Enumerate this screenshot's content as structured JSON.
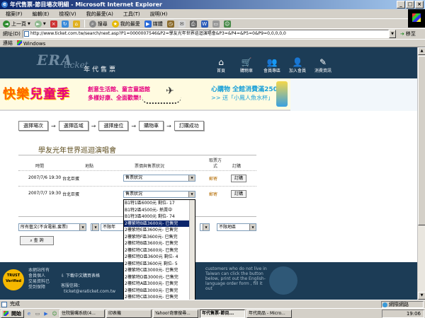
{
  "window": {
    "title": "年代售票-節目場次明細 - Microsoft Internet Explorer",
    "controls": [
      "_",
      "□",
      "×"
    ]
  },
  "menu": [
    "檔案(F)",
    "編輯(E)",
    "檢視(V)",
    "我的最愛(A)",
    "工具(T)",
    "說明(H)"
  ],
  "toolbar": {
    "back": "上一頁",
    "search": "搜尋",
    "favorites": "我的最愛",
    "media": "媒體"
  },
  "address": {
    "label": "網址(D)",
    "url": "http://www.ticket.com.tw/search/next.asp?P1=0000007546&P2=學友光年世界巡迴演唱會&P3=&P4=&P5=0&P9=0,0,0,0,0",
    "go": "移至"
  },
  "links": {
    "label": "連結",
    "item": "Windows"
  },
  "site": {
    "logo": "ERA",
    "logo_sub": "ticket",
    "name": "年代售票",
    "nav": [
      {
        "icon": "⌂",
        "label": "首頁"
      },
      {
        "icon": "🛒",
        "label": "購物車"
      },
      {
        "icon": "👥",
        "label": "會員專區"
      },
      {
        "icon": "👤",
        "label": "加入會員"
      },
      {
        "icon": "✎",
        "label": "消費資訊"
      }
    ]
  },
  "banner": {
    "title_a": "快樂",
    "title_b": "兒童季",
    "slogan1": "創意生活館、童言童語館",
    "slogan2": "多樣好康、全面歡樂!",
    "buy1": "心購物 全館消費滿2500",
    "buy2": ">> 送「小鳳人魚水杯」"
  },
  "steps": [
    "選擇場次",
    "選擇區域",
    "選擇座位",
    "購物車",
    "訂購成功"
  ],
  "event": {
    "title": "學友光年世界巡迴演唱會",
    "headers": [
      "時間",
      "地點",
      "票價與售票狀況",
      "取票方式",
      "訂購"
    ],
    "rows": [
      {
        "time": "2007/7/6 19:30",
        "place": "台北巨蛋",
        "status": "售票狀況",
        "pickup": "郵寄",
        "buy": "訂購"
      },
      {
        "time": "2007/7/7 19:30",
        "place": "台北巨蛋",
        "status": "售票狀況",
        "pickup": "郵寄",
        "buy": "訂購"
      }
    ]
  },
  "dropdown": {
    "items": [
      "B1特1區6000元 剩位- 17",
      "B1特2區4500元- 熱賣中",
      "B1特3區4000元 剩位- 74",
      "2樓紫特B區3600元- 已售完",
      "2樓紫特E區3600元- 已售完",
      "2樓紫特F區3600元- 已售完",
      "2樓紅特B區3600元- 已售完",
      "2樓紅特C區3600元- 已售完",
      "2樓紅特D區3600元 剩位- 4",
      "2樓紅特E區3600元 剩位- 5",
      "2樓紫特C區3000元- 已售完",
      "2樓紫特D區3000元- 已售完",
      "2樓紅特A區3000元- 已售完",
      "2樓紅特B區3000元- 已售完",
      "2樓紅特C區3000元- 已售完",
      "2樓紅特D區3000元- 已售完",
      "2樓紅特E區3000元- 已售完"
    ],
    "selected_index": 3
  },
  "filters": {
    "category": "所有藝文(不含電影,套票)",
    "date": "不限年",
    "region": "不限地區",
    "search": "查 詢"
  },
  "footer": {
    "trust": "TRUST Verified",
    "text1": "本網站所有",
    "text2": "會員個人",
    "text3": "交易資料已",
    "text4": "受到保障",
    "download": "下載中文購買表格",
    "mail_label": "客服信箱：",
    "mail": "ticket@eraticket.com.tw",
    "eng": "customers who do not live in Taiwan can click the button below, print out the English-language order form , fill it out"
  },
  "status": {
    "text": "完成",
    "zone": "網際網路"
  },
  "taskbar": {
    "start": "開始",
    "items": [
      "住院醫囑系統(4...",
      "印表機",
      "Yahoo!奇摩搜尋...",
      "年代售票-節目...",
      "年代商品 - Micro..."
    ],
    "active_index": 3,
    "clock": "19:06"
  }
}
